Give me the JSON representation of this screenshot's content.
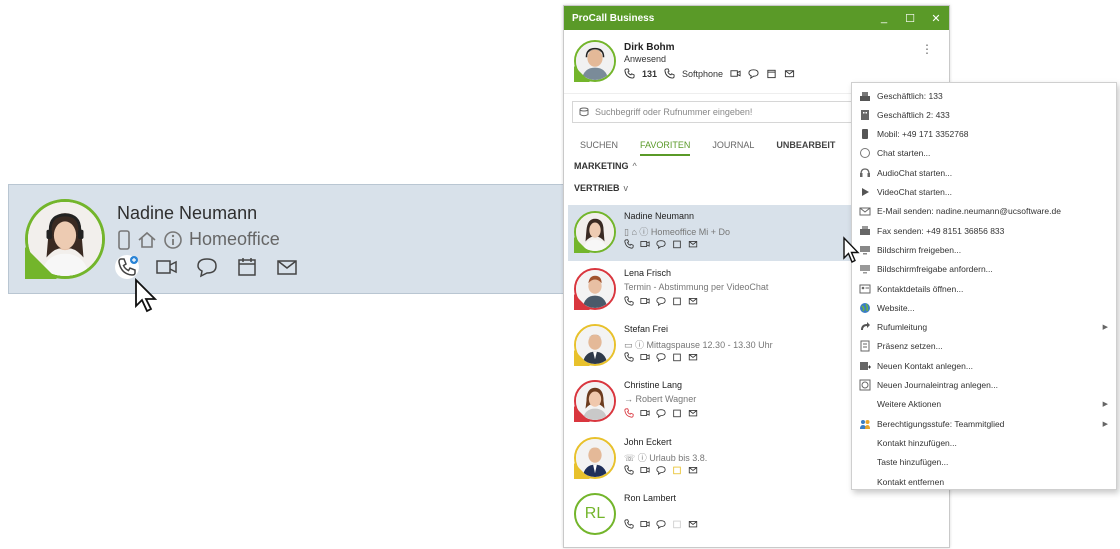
{
  "zoom_card": {
    "name": "Nadine Neumann",
    "status_text": "Homeoffice"
  },
  "window": {
    "title": "ProCall Business",
    "controls": [
      "_",
      "☐",
      "✕"
    ],
    "me": {
      "name": "Dirk Bohm",
      "status": "Anwesend",
      "ext": "131",
      "device": "Softphone"
    },
    "search_placeholder": "Suchbegriff oder Rufnummer eingeben!",
    "tabs": [
      {
        "label": "SUCHEN"
      },
      {
        "label": "FAVORITEN"
      },
      {
        "label": "JOURNAL"
      },
      {
        "label": "UNBEARBEIT"
      }
    ],
    "groups": [
      {
        "label": "MARKETING",
        "chevron": "^"
      },
      {
        "label": "VERTRIEB",
        "chevron": "v"
      }
    ],
    "contacts": [
      {
        "name": "Nadine Neumann",
        "sub": "Homeoffice Mi + Do",
        "presence": "#73b52b"
      },
      {
        "name": "Lena Frisch",
        "sub": "Termin - Abstimmung per VideoChat",
        "presence": "#d9363e"
      },
      {
        "name": "Stefan Frei",
        "sub": "Mittagspause 12.30 - 13.30 Uhr",
        "presence": "#e8c12c"
      },
      {
        "name": "Christine Lang",
        "sub": "→ Robert Wagner",
        "presence": "#d9363e"
      },
      {
        "name": "John Eckert",
        "sub": "Urlaub bis 3.8.",
        "presence": "#e8c12c"
      },
      {
        "name": "Ron Lambert",
        "sub": "",
        "initials": "RL",
        "presence": "#73b52b"
      }
    ]
  },
  "context_menu": {
    "items": [
      {
        "label": "Geschäftlich: 133",
        "icon": "phone-desk-icon"
      },
      {
        "label": "Geschäftlich 2: 433",
        "icon": "building-icon"
      },
      {
        "label": "Mobil: +49 171 3352768",
        "icon": "mobile-icon"
      },
      {
        "label": "Chat starten...",
        "icon": "chat-icon"
      },
      {
        "label": "AudioChat starten...",
        "icon": "headset-icon"
      },
      {
        "label": "VideoChat starten...",
        "icon": "play-icon"
      },
      {
        "label": "E-Mail senden: nadine.neumann@ucsoftware.de",
        "icon": "mail-icon"
      },
      {
        "label": "Fax senden: +49 8151 36856 833",
        "icon": "fax-icon"
      },
      {
        "label": "Bildschirm freigeben...",
        "icon": "screen-share-icon"
      },
      {
        "label": "Bildschirmfreigabe anfordern...",
        "icon": "screen-request-icon"
      },
      {
        "label": "Kontaktdetails öffnen...",
        "icon": "contact-card-icon"
      },
      {
        "label": "Website...",
        "icon": "globe-icon"
      },
      {
        "label": "Rufumleitung",
        "icon": "forward-icon",
        "submenu": true
      },
      {
        "label": "Präsenz setzen...",
        "icon": "presence-icon"
      },
      {
        "label": "Neuen Kontakt anlegen...",
        "icon": "new-contact-icon"
      },
      {
        "label": "Neuen Journaleintrag anlegen...",
        "icon": "journal-icon"
      },
      {
        "label": "Weitere Aktionen",
        "icon": "",
        "submenu": true
      },
      {
        "label": "Berechtigungsstufe: Teammitglied",
        "icon": "people-icon",
        "submenu": true
      },
      {
        "label": "Kontakt hinzufügen...",
        "icon": ""
      },
      {
        "label": "Taste hinzufügen...",
        "icon": ""
      },
      {
        "label": "Kontakt entfernen",
        "icon": ""
      }
    ]
  },
  "colors": {
    "accent": "#5a9a28",
    "present": "#73b52b",
    "busy": "#d9363e",
    "away": "#e8c12c",
    "selection": "#d8e1ea"
  }
}
